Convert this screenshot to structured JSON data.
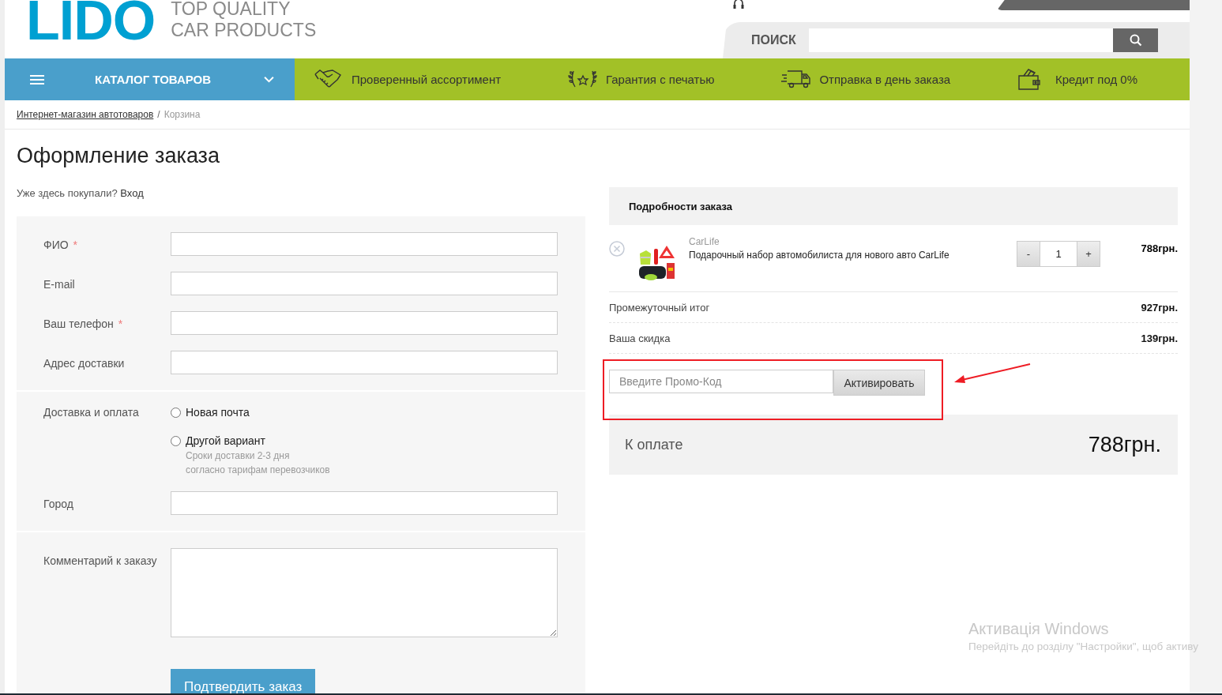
{
  "logo": {
    "mark": "LIDO",
    "tagline": [
      "TOP QUALITY",
      "CAR PRODUCTS"
    ]
  },
  "search": {
    "label": "ПОИСК"
  },
  "catalog_menu": {
    "label": "КАТАЛОГ ТОВАРОВ",
    "expanded": false
  },
  "features": [
    {
      "kind": "handshake",
      "label": "Проверенный ассортимент"
    },
    {
      "kind": "laurel",
      "label": "Гарантия с печатью"
    },
    {
      "kind": "truck",
      "label": "Отправка в день заказа"
    },
    {
      "kind": "wallet",
      "label": "Кредит под 0%"
    }
  ],
  "breadcrumbs": [
    {
      "label": "Интернет-магазин автотоваров",
      "link": true
    },
    {
      "label": "Корзина",
      "link": false
    }
  ],
  "breadcrumb_separator": "/",
  "page_title": "Оформление заказа",
  "login_prompt": {
    "text": "Уже здесь покупали?",
    "link": "Вход"
  },
  "form": {
    "required_mark": "*",
    "fields": [
      {
        "label": "ФИО",
        "required": true
      },
      {
        "label": "E-mail",
        "required": false
      },
      {
        "label": "Ваш телефон",
        "required": true
      },
      {
        "label": "Адрес доставки",
        "required": false
      }
    ],
    "delivery": {
      "label": "Доставка и оплата",
      "options": [
        {
          "label": "Новая почта",
          "selected": false
        },
        {
          "label": "Другой вариант",
          "selected": false,
          "notes": [
            "Сроки доставки 2-3 дня",
            "согласно тарифам перевозчиков"
          ]
        }
      ]
    },
    "city_field": {
      "label": "Город"
    },
    "comment_field": {
      "label": "Комментарий к заказу"
    },
    "submit": "Подтвердить заказ"
  },
  "order": {
    "title": "Подробности заказа",
    "items": [
      {
        "brand": "CarLife",
        "name": "Подарочный набор автомобилиста для нового авто CarLife",
        "decrement": "-",
        "quantity": "1",
        "increment": "+",
        "price": "788грн."
      }
    ],
    "totals": [
      {
        "label": "Промежуточный итог",
        "value": "927грн."
      },
      {
        "label": "Ваша скидка",
        "value": "139грн."
      }
    ],
    "promo": {
      "placeholder": "Введите Промо-Код",
      "button": "Активировать"
    },
    "payable": {
      "label": "К оплате",
      "value": "788грн."
    }
  },
  "os_notice": {
    "title": "Активація Windows",
    "text": "Перейдіть до розділу \"Настройки\", щоб активу"
  }
}
